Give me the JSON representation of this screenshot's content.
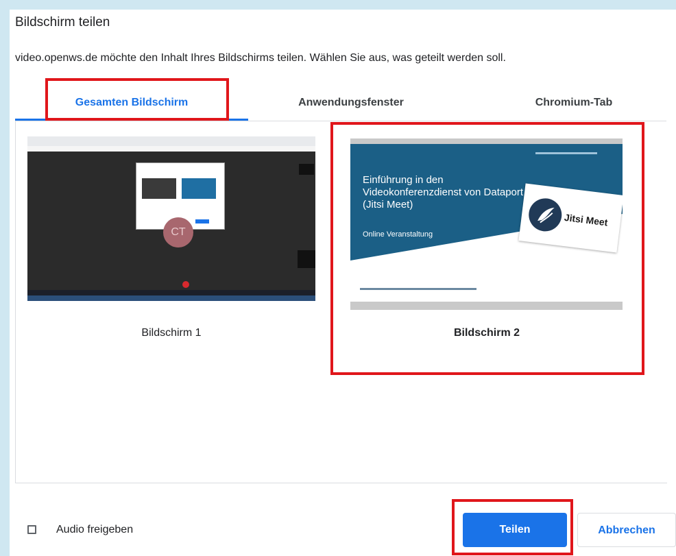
{
  "dialog": {
    "title": "Bildschirm teilen",
    "subtitle": "video.openws.de möchte den Inhalt Ihres Bildschirms teilen. Wählen Sie aus, was geteilt werden soll."
  },
  "tabs": [
    {
      "label": "Gesamten Bildschirm",
      "active": true
    },
    {
      "label": "Anwendungsfenster",
      "active": false
    },
    {
      "label": "Chromium-Tab",
      "active": false
    }
  ],
  "screens": [
    {
      "label": "Bildschirm 1",
      "selected": false,
      "avatar_initials": "CT"
    },
    {
      "label": "Bildschirm 2",
      "selected": true,
      "slide": {
        "headline": "Einführung in den Videokonferenzdienst von Dataport (Jitsi Meet)",
        "subline": "Online Veranstaltung",
        "logo_text": "Jitsi Meet"
      }
    }
  ],
  "footer": {
    "audio_label": "Audio freigeben",
    "audio_checked": false,
    "share_label": "Teilen",
    "cancel_label": "Abbrechen"
  },
  "colors": {
    "accent": "#1a73e8",
    "highlight_red": "#e0161b",
    "page_background": "#cfe7f1"
  }
}
